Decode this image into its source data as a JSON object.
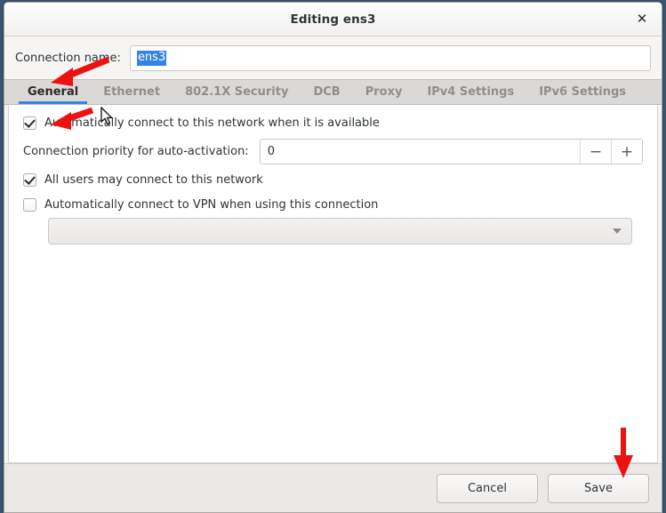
{
  "window": {
    "title": "Editing ens3",
    "close_icon": "close-icon"
  },
  "connection_name": {
    "label": "Connection name:",
    "value": "ens3",
    "placeholder": ""
  },
  "tabs": [
    {
      "label": "General",
      "active": true
    },
    {
      "label": "Ethernet",
      "active": false
    },
    {
      "label": "802.1X Security",
      "active": false
    },
    {
      "label": "DCB",
      "active": false
    },
    {
      "label": "Proxy",
      "active": false
    },
    {
      "label": "IPv4 Settings",
      "active": false
    },
    {
      "label": "IPv6 Settings",
      "active": false
    }
  ],
  "general": {
    "auto_connect": {
      "label": "Automatically connect to this network when it is available",
      "checked": true
    },
    "priority": {
      "label": "Connection priority for auto-activation:",
      "value": "0",
      "minus_label": "−",
      "plus_label": "+"
    },
    "all_users": {
      "label": "All users may connect to this network",
      "checked": true
    },
    "auto_vpn": {
      "label": "Automatically connect to VPN when using this connection",
      "checked": false
    },
    "vpn_combo": {
      "value": "",
      "arrow_icon": "chevron-down-icon"
    }
  },
  "actions": {
    "cancel_label": "Cancel",
    "save_label": "Save"
  },
  "colors": {
    "accent": "#3584e4",
    "selection": "#3584e4",
    "annotation": "#ee1111",
    "window_bg": "#f6f5f4",
    "tabstrip_bg": "#dbd9d7",
    "desktop_bg": "#3b5573"
  },
  "annotations": [
    {
      "name": "arrow-to-general-tab",
      "color": "#ee1111"
    },
    {
      "name": "arrow-to-autoconnect-checkbox",
      "color": "#ee1111"
    },
    {
      "name": "arrow-to-save-button",
      "color": "#ee1111"
    }
  ]
}
